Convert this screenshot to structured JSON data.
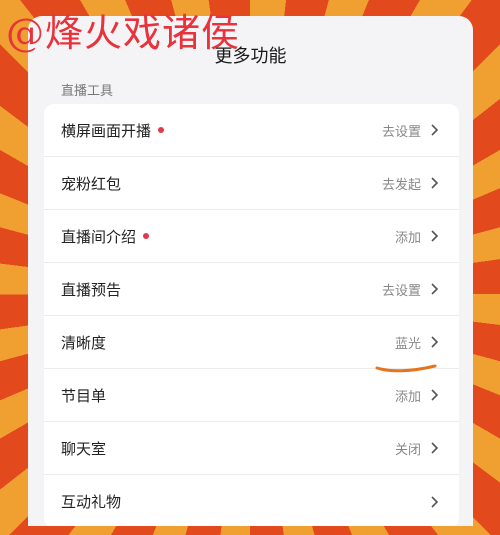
{
  "watermark": "@烽火戏诸侯",
  "panel": {
    "title": "更多功能"
  },
  "section": {
    "label": "直播工具"
  },
  "rows": [
    {
      "label": "横屏画面开播",
      "value": "去设置",
      "dot": true
    },
    {
      "label": "宠粉红包",
      "value": "去发起",
      "dot": false
    },
    {
      "label": "直播间介绍",
      "value": "添加",
      "dot": true
    },
    {
      "label": "直播预告",
      "value": "去设置",
      "dot": false
    },
    {
      "label": "清晰度",
      "value": "蓝光",
      "dot": false
    },
    {
      "label": "节目单",
      "value": "添加",
      "dot": false
    },
    {
      "label": "聊天室",
      "value": "关闭",
      "dot": false
    },
    {
      "label": "互动礼物",
      "value": "",
      "dot": false
    }
  ],
  "colors": {
    "dot": "#e03a4a",
    "annotation": "#e8731e",
    "watermark": "#e8323c"
  },
  "icons": {
    "row_arrow": "chevron-right-icon"
  }
}
